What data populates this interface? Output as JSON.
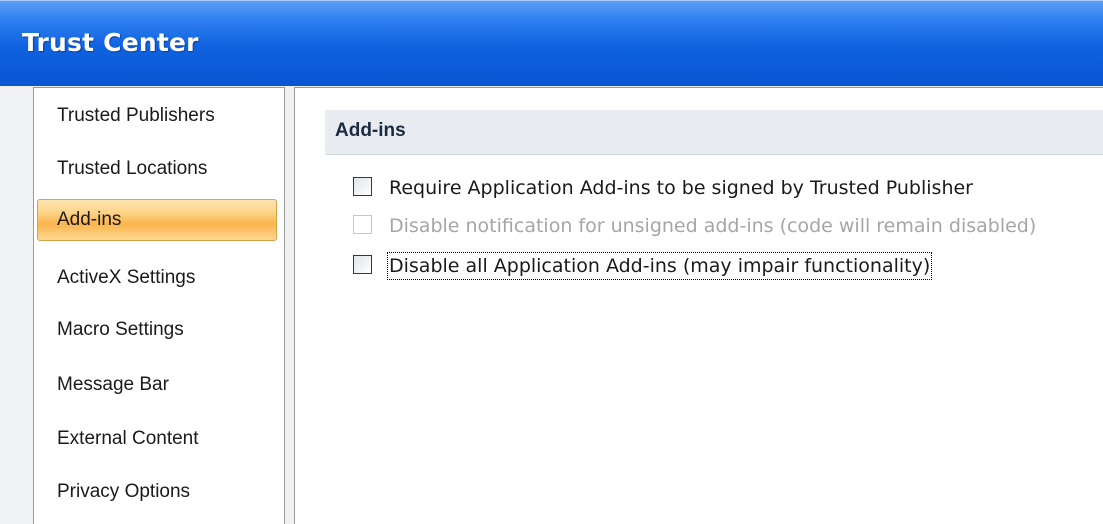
{
  "window": {
    "title": "Trust Center"
  },
  "sidebar": {
    "items": [
      {
        "label": "Trusted Publishers"
      },
      {
        "label": "Trusted Locations"
      },
      {
        "label": "Add-ins",
        "selected": true
      },
      {
        "label": "ActiveX Settings"
      },
      {
        "label": "Macro Settings"
      },
      {
        "label": "Message Bar"
      },
      {
        "label": "External Content"
      },
      {
        "label": "Privacy Options"
      }
    ]
  },
  "main": {
    "section_title": "Add-ins",
    "options": [
      {
        "label": "Require Application Add-ins to be signed by Trusted Publisher",
        "checked": false,
        "enabled": true
      },
      {
        "label": "Disable notification for unsigned add-ins (code will remain disabled)",
        "checked": false,
        "enabled": false
      },
      {
        "label": "Disable all Application Add-ins (may impair functionality)",
        "checked": false,
        "enabled": true,
        "focused": true
      }
    ]
  },
  "colors": {
    "titlebar": "#0a55d4",
    "selection": "#fbb44c",
    "section_header_bg": "#e8ecf1"
  }
}
